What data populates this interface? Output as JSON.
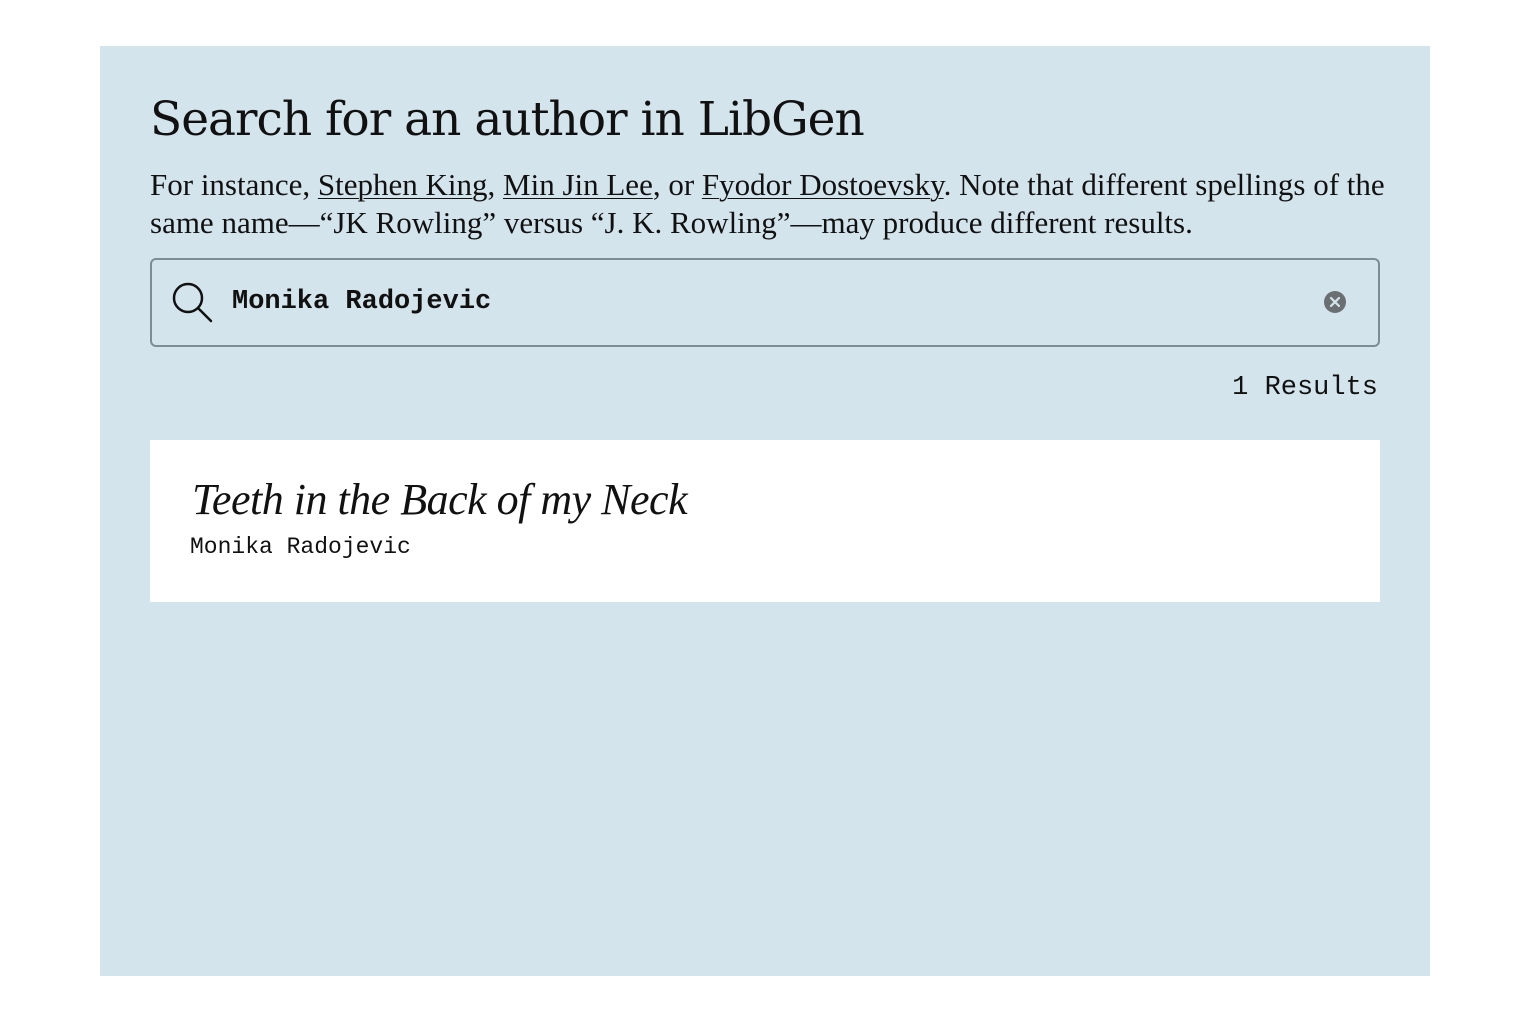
{
  "page": {
    "heading": "Search for an author in LibGen",
    "intro": {
      "prefix": "For instance, ",
      "examples": [
        "Stephen King",
        "Min Jin Lee",
        "Fyodor Dostoevsky"
      ],
      "sep1": ", ",
      "sep2": ", or ",
      "suffix": ". Note that different spellings of the same name—“JK Rowling” versus “J. K. Rowling”—may produce different results."
    }
  },
  "search": {
    "value": "Monika Radojevic",
    "icon": "search-icon",
    "clear_icon": "clear-icon"
  },
  "results": {
    "count_label": "1 Results",
    "items": [
      {
        "title": "Teeth in the Back of my Neck",
        "author": "Monika Radojevic"
      }
    ]
  },
  "colors": {
    "panel_background": "#d4e4ec",
    "card_background": "#ffffff",
    "border": "#7c8d95",
    "clear_icon": "#6b6f72"
  }
}
